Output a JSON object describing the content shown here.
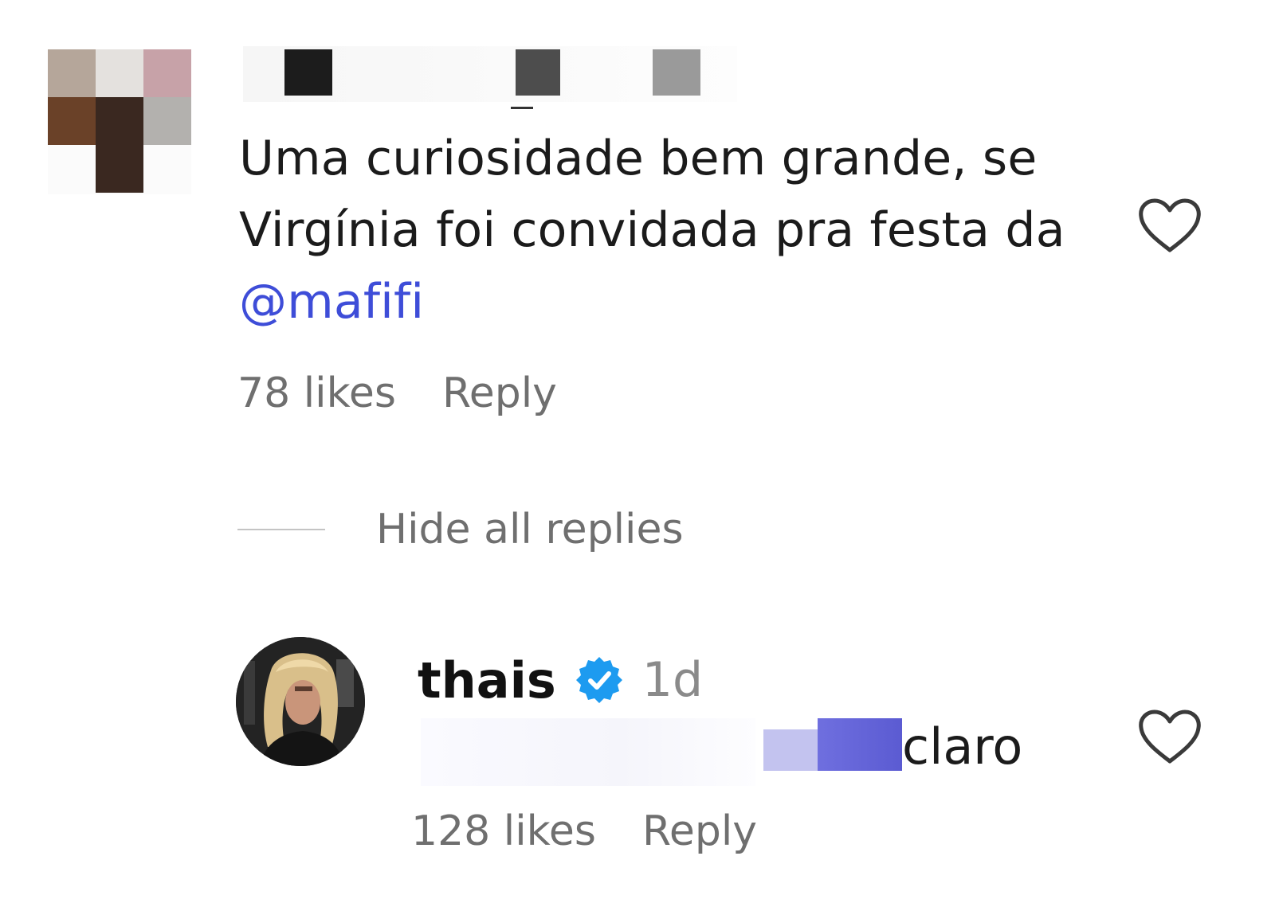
{
  "comment": {
    "text_lines": [
      "Uma curiosidade bem grande, se",
      "Virgínia foi convidada pra festa da"
    ],
    "mention": "@mafifi",
    "likes": "78 likes",
    "reply_label": "Reply",
    "like_icon": "heart-outline-icon"
  },
  "replies_toggle": {
    "label": "Hide all replies"
  },
  "reply": {
    "username": "thais",
    "verified_icon": "verified-badge-icon",
    "time": "1d",
    "text": "claro",
    "likes": "128 likes",
    "reply_label": "Reply",
    "like_icon": "heart-outline-icon"
  },
  "colors": {
    "mention": "#3e4dd8",
    "verified": "#1d9bf0",
    "meta_text": "#6f6f6f",
    "body_text": "#1b1b1b"
  }
}
